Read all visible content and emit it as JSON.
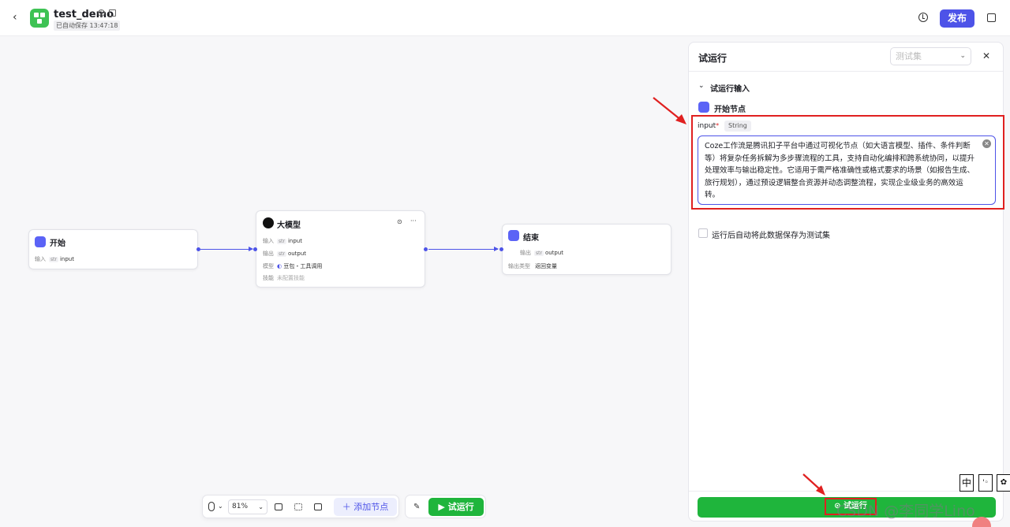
{
  "header": {
    "title": "test_demo",
    "autosave": "已自动保存 13:47:18",
    "publish_label": "发布"
  },
  "nodes": {
    "start": {
      "title": "开始",
      "input_label": "输入",
      "input_type": "str",
      "input_name": "input"
    },
    "llm": {
      "title": "大模型",
      "input_label": "输入",
      "input_type": "str",
      "input_name": "input",
      "output_label": "输出",
      "output_type": "str",
      "output_name": "output",
      "model_label": "模型",
      "model_value": "豆包・工具调用",
      "skill_label": "技能",
      "skill_value": "未配置技能"
    },
    "end": {
      "title": "结束",
      "output_label": "输出",
      "output_type": "str",
      "output_name": "output",
      "output_kind_label": "输出类型",
      "output_kind_value": "返回变量"
    }
  },
  "toolbar": {
    "zoom": "81%",
    "add_node_label": "添加节点",
    "test_run_label": "试运行"
  },
  "panel": {
    "title": "试运行",
    "testset_placeholder": "测试集",
    "section_title": "试运行输入",
    "start_node_label": "开始节点",
    "field_name": "input",
    "field_required_mark": "*",
    "field_type": "String",
    "field_value": "Coze工作流是腾讯扣子平台中通过可视化节点（如大语言模型、插件、条件判断等）将复杂任务拆解为多步骤流程的工具，支持自动化编排和跨系统协同，以提升处理效率与输出稳定性。它适用于需严格准确性或格式要求的场景（如报告生成、旅行规划），通过预设逻辑整合资源并动态调整流程，实现企业级业务的高效运转。",
    "save_checkbox_label": "运行后自动将此数据保存为测试集",
    "run_button_label": "试运行"
  },
  "overlay": {
    "ime_char": "中",
    "watermark": "CSDN @李同学Lino"
  },
  "colors": {
    "accent": "#4d53e8",
    "run_green": "#1fb53c",
    "highlight_red": "#e02020"
  }
}
